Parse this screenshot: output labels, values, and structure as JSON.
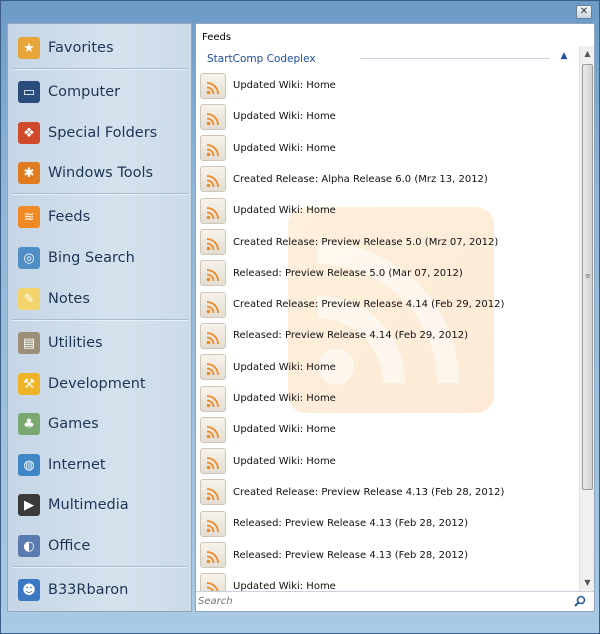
{
  "window": {
    "close_glyph": "✕"
  },
  "sidebar": {
    "items": [
      {
        "label": "Favorites",
        "icon": "star-icon",
        "color": "#e8a53a",
        "glyph": "★"
      },
      {
        "label": "Computer",
        "icon": "computer-icon",
        "color": "#2a4c7d",
        "glyph": "▭"
      },
      {
        "label": "Special Folders",
        "icon": "special-folders-icon",
        "color": "#d04a2c",
        "glyph": "❖"
      },
      {
        "label": "Windows Tools",
        "icon": "windows-tools-icon",
        "color": "#e07b20",
        "glyph": "✱"
      },
      {
        "label": "Feeds",
        "icon": "rss-feed-icon",
        "color": "#f08a24",
        "glyph": "≋"
      },
      {
        "label": "Bing Search",
        "icon": "bing-search-icon",
        "color": "#4f8fc5",
        "glyph": "◎"
      },
      {
        "label": "Notes",
        "icon": "notes-icon",
        "color": "#f2d36c",
        "glyph": "✎"
      },
      {
        "label": "Utilities",
        "icon": "utilities-icon",
        "color": "#9b8f77",
        "glyph": "▤"
      },
      {
        "label": "Development",
        "icon": "development-icon",
        "color": "#f0b428",
        "glyph": "⚒"
      },
      {
        "label": "Games",
        "icon": "games-icon",
        "color": "#7aa870",
        "glyph": "♣"
      },
      {
        "label": "Internet",
        "icon": "internet-icon",
        "color": "#3f86c6",
        "glyph": "◍"
      },
      {
        "label": "Multimedia",
        "icon": "multimedia-icon",
        "color": "#3b3b3b",
        "glyph": "▶"
      },
      {
        "label": "Office",
        "icon": "office-icon",
        "color": "#5a7bb0",
        "glyph": "◐"
      },
      {
        "label": "B33Rbaron",
        "icon": "user-avatar-icon",
        "color": "#3a78c2",
        "glyph": "☻"
      }
    ]
  },
  "feeds": {
    "header": "Feeds",
    "group": "StartComp Codeplex",
    "group_chevron": "▲",
    "items": [
      "Updated Wiki: Home",
      "Updated Wiki: Home",
      "Updated Wiki: Home",
      "Created Release: Alpha Release 6.0 (Mrz 13, 2012)",
      "Updated Wiki: Home",
      "Created Release: Preview Release 5.0 (Mrz 07, 2012)",
      "Released: Preview Release 5.0 (Mar 07, 2012)",
      "Created Release: Preview Release 4.14 (Feb 29, 2012)",
      "Released: Preview Release 4.14 (Feb 29, 2012)",
      "Updated Wiki: Home",
      "Updated Wiki: Home",
      "Updated Wiki: Home",
      "Updated Wiki: Home",
      "Created Release: Preview Release 4.13 (Feb 28, 2012)",
      "Released: Preview Release 4.13 (Feb 28, 2012)",
      "Released: Preview Release 4.13 (Feb 28, 2012)",
      "Updated Wiki: Home"
    ]
  },
  "scrollbar": {
    "up_glyph": "▲",
    "down_glyph": "▼",
    "grip_glyph": "≡"
  },
  "search": {
    "placeholder": "Search"
  }
}
